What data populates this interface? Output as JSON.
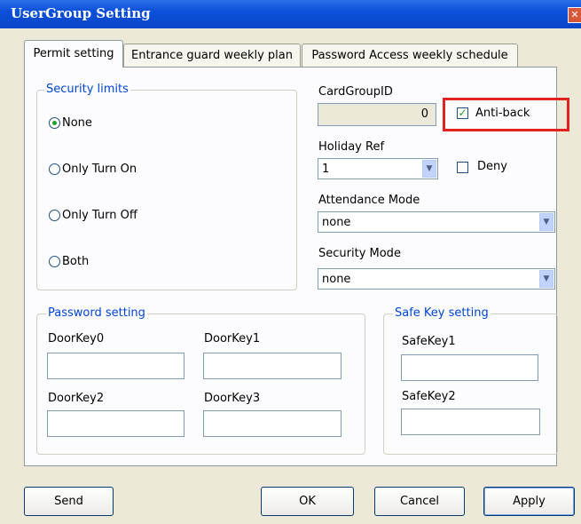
{
  "window": {
    "title": "UserGroup Setting",
    "close_glyph": "✕"
  },
  "tabs": [
    {
      "label": "Permit setting",
      "active": true
    },
    {
      "label": "Entrance guard weekly plan",
      "active": false
    },
    {
      "label": "Password Access weekly schedule",
      "active": false
    }
  ],
  "security_limits": {
    "legend": "Security limits",
    "options": [
      {
        "label": "None",
        "selected": true
      },
      {
        "label": "Only Turn On",
        "selected": false
      },
      {
        "label": "Only Turn Off",
        "selected": false
      },
      {
        "label": "Both",
        "selected": false
      }
    ]
  },
  "card_group": {
    "label": "CardGroupID",
    "value": "0"
  },
  "anti_back": {
    "label": "Anti-back",
    "checked": true
  },
  "holiday": {
    "label": "Holiday Ref",
    "value": "1"
  },
  "deny": {
    "label": "Deny",
    "checked": false
  },
  "attendance": {
    "label": "Attendance Mode",
    "value": "none"
  },
  "security_mode": {
    "label": "Security Mode",
    "value": "none"
  },
  "password_setting": {
    "legend": "Password setting",
    "fields": [
      {
        "label": "DoorKey0",
        "value": ""
      },
      {
        "label": "DoorKey1",
        "value": ""
      },
      {
        "label": "DoorKey2",
        "value": ""
      },
      {
        "label": "DoorKey3",
        "value": ""
      }
    ]
  },
  "safe_key_setting": {
    "legend": "Safe Key setting",
    "fields": [
      {
        "label": "SafeKey1",
        "value": ""
      },
      {
        "label": "SafeKey2",
        "value": ""
      }
    ]
  },
  "buttons": {
    "send": "Send",
    "ok": "OK",
    "cancel": "Cancel",
    "apply": "Apply"
  },
  "colors": {
    "titlebar": "#0b4fd9",
    "legend": "#0046d5",
    "highlight": "#e2221e",
    "check": "#21a121"
  },
  "icons": {
    "close": "close-icon",
    "dropdown": "chevron-down-icon",
    "checkmark": "checkmark-icon"
  }
}
